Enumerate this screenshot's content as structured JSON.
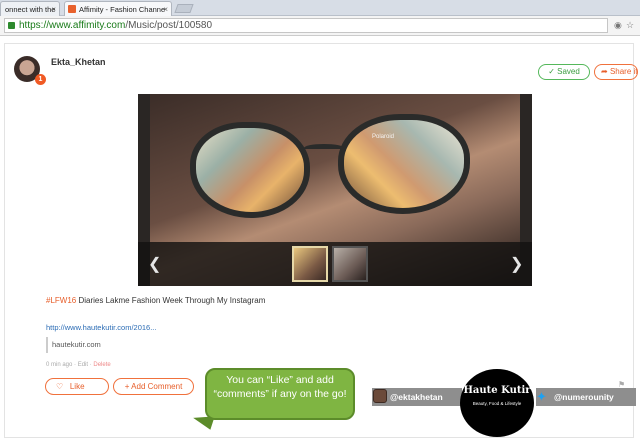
{
  "browser": {
    "tabs": [
      {
        "label": "onnect with the"
      },
      {
        "label": "Affimity - Fashion Channe"
      }
    ],
    "tab_close": "×",
    "url_host": "https://www.affimity.com",
    "url_path": "/Music/post/100580"
  },
  "post": {
    "username": "Ekta_Khetan",
    "notification_count": "1",
    "saved_label": "Saved",
    "share_label": "Share it!",
    "image_brand": "Polaroid",
    "hashtag": "#LFW16",
    "title_rest": " Diaries Lakme Fashion Week Through My Instagram",
    "link": "http://www.hautekutir.com/2016...",
    "domain": "hautekutir.com",
    "meta_time": "0 min ago",
    "meta_edit": "Edit",
    "meta_delete": "Delete",
    "like_label": "Like",
    "comment_label": "+ Add Comment"
  },
  "callout": {
    "text": "You can “Like” and add “comments” if any on the go!"
  },
  "footer": {
    "instagram_handle": "@ektakhetan",
    "twitter_handle": "@numerounity",
    "logo_title": "Haute Kutir",
    "logo_subtitle": "Beauty, Food & Lifestyle"
  },
  "colors": {
    "accent": "#e75e2a",
    "saved_green": "#3c9d42",
    "callout_green": "#7fb542",
    "link_blue": "#2b6cb5"
  }
}
